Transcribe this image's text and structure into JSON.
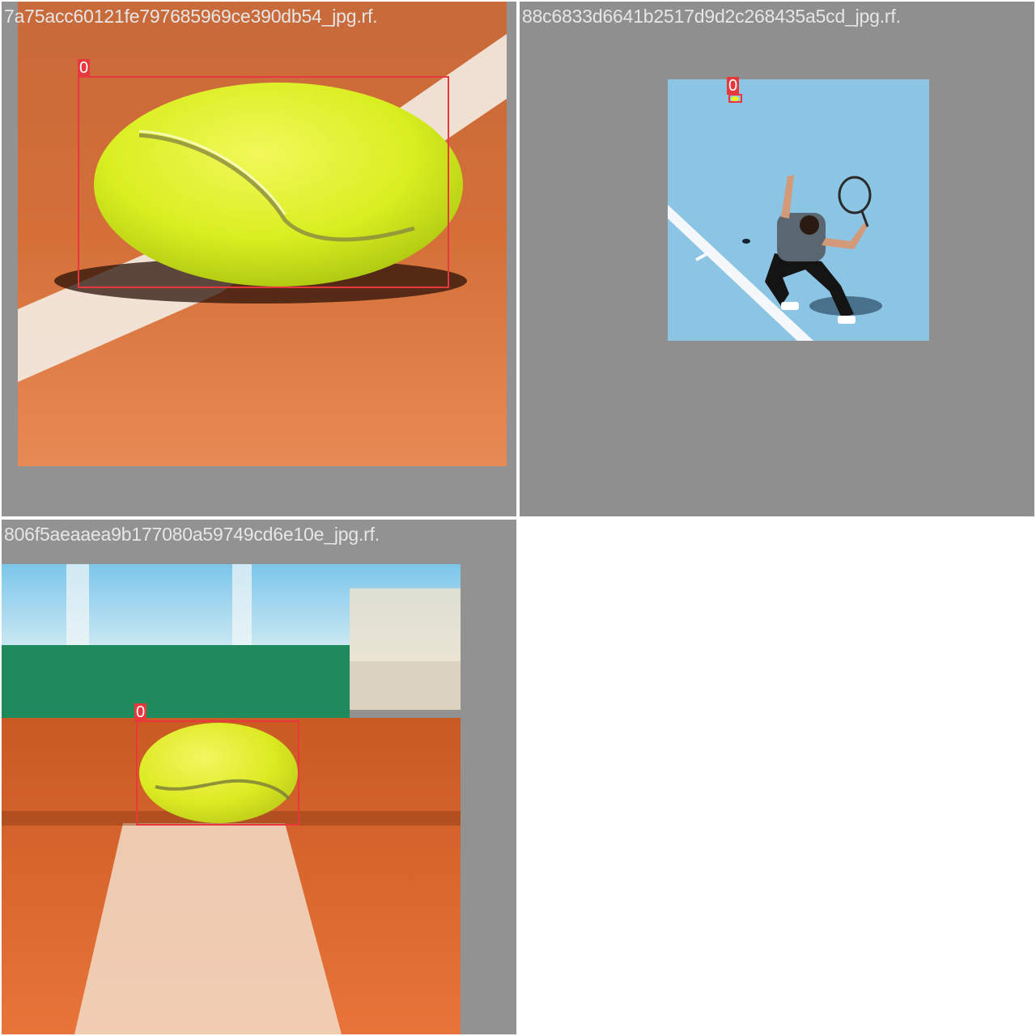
{
  "mosaic": {
    "tiles": [
      {
        "filename": "7a75acc60121fe797685969ce390db54_jpg.rf.",
        "detections": [
          {
            "class_label": "0",
            "depicts": "tennis-ball"
          }
        ],
        "scene": "tennis ball on clay court"
      },
      {
        "filename": "88c6833d6641b2517d9d2c268435a5cd_jpg.rf.",
        "detections": [
          {
            "class_label": "0",
            "depicts": "tennis-ball"
          }
        ],
        "scene": "tennis player serving on blue hard court"
      },
      {
        "filename": "806f5aeaaea9b177080a59749cd6e10e_jpg.rf.",
        "detections": [
          {
            "class_label": "0",
            "depicts": "tennis-ball"
          }
        ],
        "scene": "tennis ball on clay court line"
      }
    ]
  },
  "colors": {
    "bbox": "#e8383d",
    "tile_background": "#929292",
    "page_background": "#ffffff",
    "filename_text": "#e6e6e6"
  }
}
